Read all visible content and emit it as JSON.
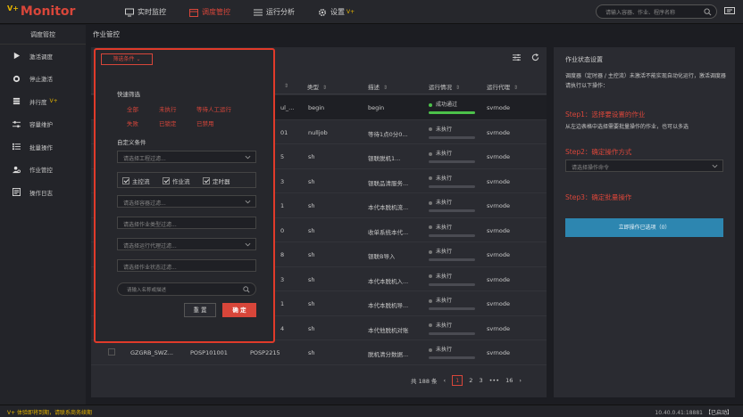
{
  "header": {
    "brand": "Monitor",
    "brand_badge": "V+",
    "nav": [
      {
        "label": "实时监控",
        "icon": "monitor-icon"
      },
      {
        "label": "调度管控",
        "icon": "schedule-icon"
      },
      {
        "label": "运行分析",
        "icon": "analysis-icon"
      },
      {
        "label": "设置",
        "icon": "gear-icon",
        "badge": "V+"
      }
    ],
    "search_placeholder": "请输入容器、作业、程序名称"
  },
  "sidebar": {
    "title": "调度管控",
    "items": [
      {
        "label": "激活调度",
        "icon": "play-icon"
      },
      {
        "label": "停止激活",
        "icon": "stop-icon"
      },
      {
        "label": "并行度",
        "icon": "parallel-icon",
        "badge": "V+"
      },
      {
        "label": "容量维护",
        "icon": "sliders-icon"
      },
      {
        "label": "批量操作",
        "icon": "batch-icon"
      },
      {
        "label": "作业管控",
        "icon": "job-control-icon"
      },
      {
        "label": "操作日志",
        "icon": "log-icon"
      }
    ]
  },
  "breadcrumb": "作业管控",
  "table": {
    "headers": [
      {
        "label": "类型",
        "sort": "⇕"
      },
      {
        "label": "描述",
        "sort": "⇕"
      },
      {
        "label": "运行情况",
        "sort": "⇕"
      },
      {
        "label": "运行代理",
        "sort": "⇕"
      }
    ],
    "partial_header_sort": "⇕",
    "rows": [
      {
        "c3": "ul_...",
        "type": "begin",
        "desc": "begin",
        "status": "成功通过",
        "status_ok": true,
        "progress": 1.0,
        "agent": "svrnode"
      },
      {
        "c3": "01",
        "type": "nulljob",
        "desc": "等待1点0分0...",
        "status": "未执行",
        "status_ok": false,
        "progress": 0,
        "agent": "svrnode"
      },
      {
        "c3": "5",
        "type": "sh",
        "desc": "银联脱机1...",
        "status": "未执行",
        "status_ok": false,
        "progress": 0,
        "agent": "svrnode"
      },
      {
        "c3": "3",
        "type": "sh",
        "desc": "银联品清服务...",
        "status": "未执行",
        "status_ok": false,
        "progress": 0,
        "agent": "svrnode"
      },
      {
        "c3": "1",
        "type": "sh",
        "desc": "本代本脱机流...",
        "status": "未执行",
        "status_ok": false,
        "progress": 0,
        "agent": "svrnode"
      },
      {
        "c3": "0",
        "type": "sh",
        "desc": "收单系统本代...",
        "status": "未执行",
        "status_ok": false,
        "progress": 0,
        "agent": "svrnode"
      },
      {
        "c3": "8",
        "type": "sh",
        "desc": "银联B导入",
        "status": "未执行",
        "status_ok": false,
        "progress": 0,
        "agent": "svrnode"
      },
      {
        "c3": "3",
        "type": "sh",
        "desc": "本代本脱机入...",
        "status": "未执行",
        "status_ok": false,
        "progress": 0,
        "agent": "svrnode"
      },
      {
        "c3": "1",
        "type": "sh",
        "desc": "本代本脱机导...",
        "status": "未执行",
        "status_ok": false,
        "progress": 0,
        "agent": "svrnode"
      },
      {
        "c3": "4",
        "type": "sh",
        "desc": "本代他脱机对账",
        "status": "未执行",
        "status_ok": false,
        "progress": 0,
        "agent": "svrnode"
      },
      {
        "c0": "GZGRB_SWZ...",
        "c1": "POSP101001",
        "c2": "POSP2215",
        "type": "sh",
        "desc": "脱机清分数据...",
        "status": "未执行",
        "status_ok": false,
        "progress": 0,
        "agent": "svrnode"
      }
    ]
  },
  "pager": {
    "total": "共 188 条",
    "prev": "‹",
    "pages": [
      "1",
      "2",
      "3"
    ],
    "ellipsis": "•••",
    "last": "16",
    "next": "›"
  },
  "filter": {
    "tab": "筛选条件",
    "tab_chevron": "⌄",
    "quick_title": "快速筛选",
    "quick": [
      "全部",
      "未执行",
      "等待人工运行",
      "失败",
      "已锁定",
      "已禁用"
    ],
    "custom_title": "自定义条件",
    "project_placeholder": "请选择工程过滤...",
    "checks": [
      "主控流",
      "作业流",
      "定时器"
    ],
    "container_placeholder": "请选择容器过滤...",
    "job_type_placeholder": "请选择作业类型过滤...",
    "agent_placeholder": "请选择运行代理过滤...",
    "job_status_placeholder": "请选择作业状态过滤...",
    "search_placeholder": "请输入名称或描述",
    "reset": "重 置",
    "ok": "确 定"
  },
  "right_panel": {
    "title": "作业状态设置",
    "desc": "调度器（定时器 / 主控流）未激活不能实现自动化运行，激活调度器请执行以下操作：",
    "step1": "Step1：选择要设置的作业",
    "step1_desc": "从左边表格中选择需要批量操作的作业，也可以多选",
    "step2": "Step2：确定操作方式",
    "action_placeholder": "请选择操作命令",
    "step3": "Step3：确定批量操作",
    "button": "立即操作已选项（0）"
  },
  "footer": {
    "left": "V+ 体验即将到期，请联系商务续期",
    "right": "10.40.0.41:18881",
    "status": "【已启动】"
  },
  "colors": {
    "accent": "#d8463a",
    "success": "#4cc14a",
    "primary": "#2d86b0",
    "vip": "#e4b300"
  }
}
